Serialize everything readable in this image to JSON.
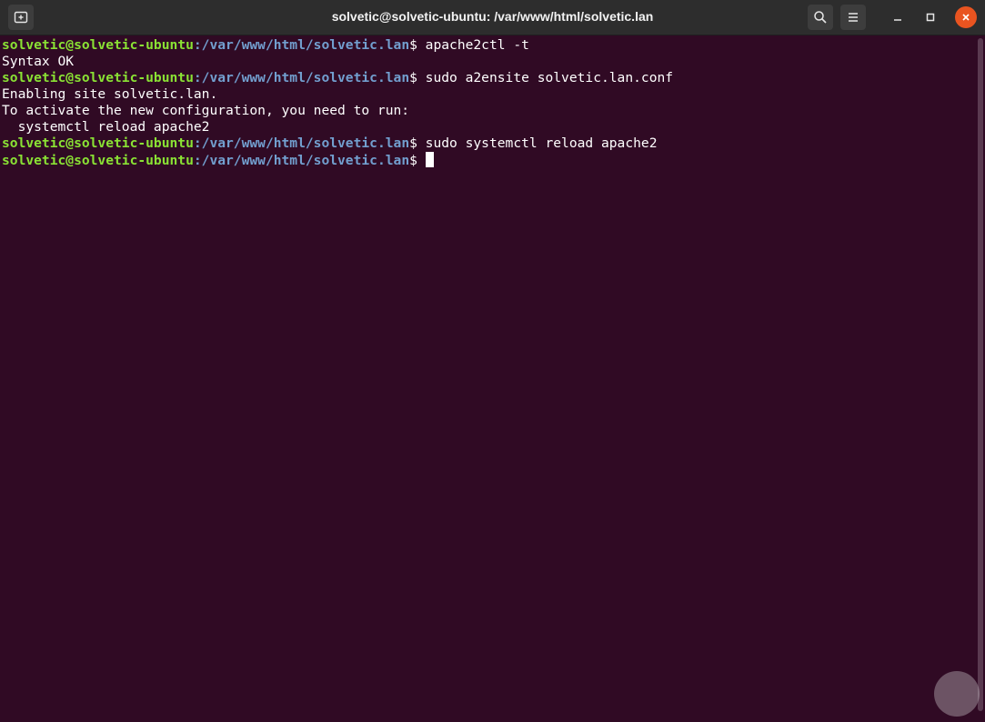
{
  "window": {
    "title": "solvetic@solvetic-ubuntu: /var/www/html/solvetic.lan"
  },
  "colors": {
    "background": "#300a24",
    "prompt_user": "#8ae234",
    "prompt_path": "#729fcf",
    "close_button": "#e95420"
  },
  "icons": {
    "new_tab": "new-tab-icon",
    "search": "search-icon",
    "menu": "hamburger-menu-icon",
    "minimize": "minimize-icon",
    "maximize": "maximize-icon",
    "close": "close-icon"
  },
  "terminal": {
    "lines": [
      {
        "user": "solvetic@solvetic-ubuntu",
        "path": ":/var/www/html/solvetic.lan",
        "cmd": "$ apache2ctl -t"
      },
      {
        "output": "Syntax OK"
      },
      {
        "user": "solvetic@solvetic-ubuntu",
        "path": ":/var/www/html/solvetic.lan",
        "cmd": "$ sudo a2ensite solvetic.lan.conf"
      },
      {
        "output": "Enabling site solvetic.lan."
      },
      {
        "output": "To activate the new configuration, you need to run:"
      },
      {
        "output": "  systemctl reload apache2"
      },
      {
        "user": "solvetic@solvetic-ubuntu",
        "path": ":/var/www/html/solvetic.lan",
        "cmd": "$ sudo systemctl reload apache2"
      },
      {
        "user": "solvetic@solvetic-ubuntu",
        "path": ":/var/www/html/solvetic.lan",
        "cmd": "$ "
      }
    ]
  }
}
